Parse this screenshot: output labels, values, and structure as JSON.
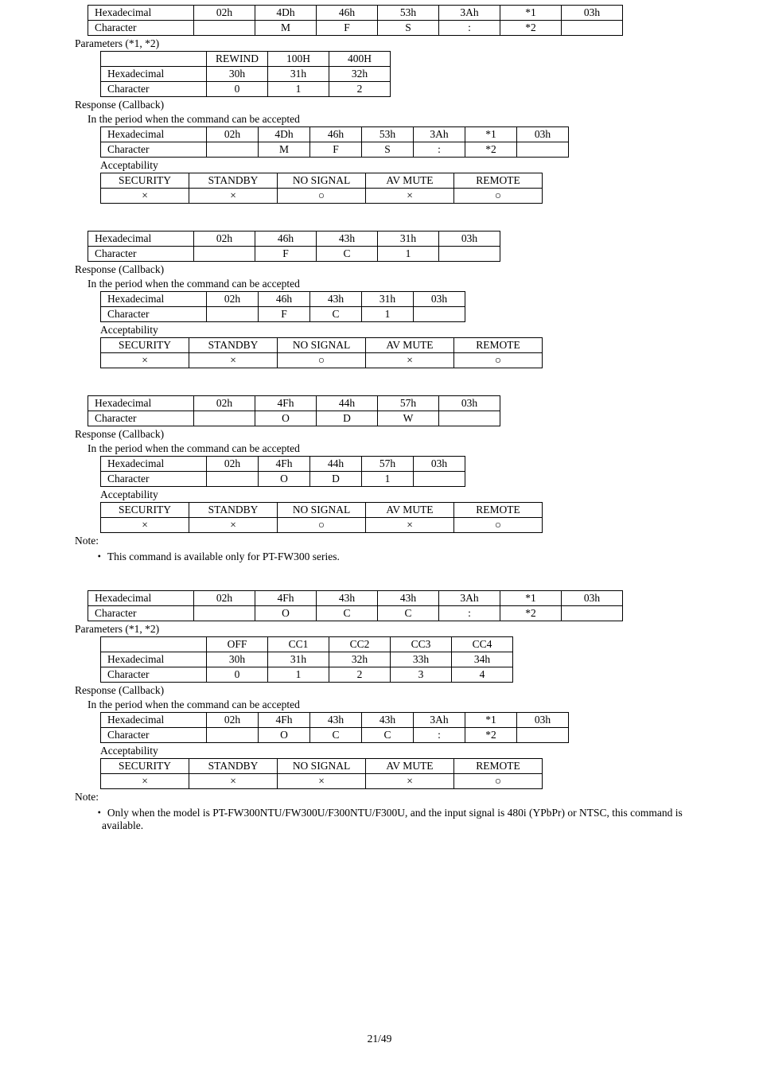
{
  "common": {
    "hexadecimal_label": "Hexadecimal",
    "character_label": "Character",
    "response_callback": "Response (Callback)",
    "period_accepted": "In the period when the command can be accepted",
    "acceptability": "Acceptability",
    "mode_security": "SECURITY",
    "mode_standby": "STANDBY",
    "mode_nosignal": "NO SIGNAL",
    "mode_avmute": "AV MUTE",
    "mode_remote": "REMOTE",
    "cross": "×",
    "circle": "○",
    "note": "Note:",
    "page_num": "21/49"
  },
  "b1": {
    "top_hex": [
      "02h",
      "4Dh",
      "46h",
      "53h",
      "3Ah",
      "*1",
      "03h"
    ],
    "top_chr": [
      "",
      "M",
      "F",
      "S",
      ":",
      "*2",
      ""
    ],
    "params_label": "Parameters (*1, *2)",
    "params_head": [
      "REWIND",
      "100H",
      "400H"
    ],
    "params_hex": [
      "30h",
      "31h",
      "32h"
    ],
    "params_chr": [
      "0",
      "1",
      "2"
    ],
    "resp_hex": [
      "02h",
      "4Dh",
      "46h",
      "53h",
      "3Ah",
      "*1",
      "03h"
    ],
    "resp_chr": [
      "",
      "M",
      "F",
      "S",
      ":",
      "*2",
      ""
    ],
    "acc": [
      "×",
      "×",
      "○",
      "×",
      "○"
    ]
  },
  "b2": {
    "top_hex": [
      "02h",
      "46h",
      "43h",
      "31h",
      "03h"
    ],
    "top_chr": [
      "",
      "F",
      "C",
      "1",
      ""
    ],
    "resp_hex": [
      "02h",
      "46h",
      "43h",
      "31h",
      "03h"
    ],
    "resp_chr": [
      "",
      "F",
      "C",
      "1",
      ""
    ],
    "acc": [
      "×",
      "×",
      "○",
      "×",
      "○"
    ]
  },
  "b3": {
    "top_hex": [
      "02h",
      "4Fh",
      "44h",
      "57h",
      "03h"
    ],
    "top_chr": [
      "",
      "O",
      "D",
      "W",
      ""
    ],
    "resp_hex": [
      "02h",
      "4Fh",
      "44h",
      "57h",
      "03h"
    ],
    "resp_chr": [
      "",
      "O",
      "D",
      "1",
      ""
    ],
    "acc": [
      "×",
      "×",
      "○",
      "×",
      "○"
    ],
    "bullet": "This command is available only for PT-FW300 series."
  },
  "b4": {
    "top_hex": [
      "02h",
      "4Fh",
      "43h",
      "43h",
      "3Ah",
      "*1",
      "03h"
    ],
    "top_chr": [
      "",
      "O",
      "C",
      "C",
      ":",
      "*2",
      ""
    ],
    "params_label": "Parameters (*1, *2)",
    "params_head": [
      "OFF",
      "CC1",
      "CC2",
      "CC3",
      "CC4"
    ],
    "params_hex": [
      "30h",
      "31h",
      "32h",
      "33h",
      "34h"
    ],
    "params_chr": [
      "0",
      "1",
      "2",
      "3",
      "4"
    ],
    "resp_hex": [
      "02h",
      "4Fh",
      "43h",
      "43h",
      "3Ah",
      "*1",
      "03h"
    ],
    "resp_chr": [
      "",
      "O",
      "C",
      "C",
      ":",
      "*2",
      ""
    ],
    "acc": [
      "×",
      "×",
      "×",
      "×",
      "○"
    ],
    "bullet": "Only when the model is PT-FW300NTU/FW300U/F300NTU/F300U, and the input signal is 480i (YPbPr) or NTSC, this command is available."
  }
}
